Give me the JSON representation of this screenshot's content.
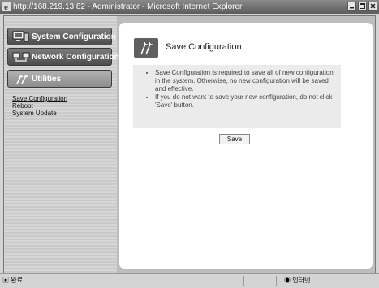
{
  "window": {
    "title": "http://168.219.13.82 - Administrator - Microsoft Internet Explorer"
  },
  "sidebar": {
    "nav": [
      {
        "label": "System Configuration",
        "icon": "monitor-icon"
      },
      {
        "label": "Network Configuration",
        "icon": "network-computers-icon"
      },
      {
        "label": "Utilities",
        "icon": "tools-icon"
      }
    ],
    "submenu": [
      {
        "label": "Save Configuration",
        "active": true
      },
      {
        "label": "Reboot",
        "active": false
      },
      {
        "label": "System Update",
        "active": false
      }
    ]
  },
  "main": {
    "title": "Save Configuration",
    "bullets": [
      "Save Configuration is required to save all of new configuration in the system. Otherwise, no new configuration will be saved and effective.",
      "If you do not want to save your new configuration, do not click 'Save' button."
    ],
    "save_label": "Save"
  },
  "statusbar": {
    "left": "완료",
    "right": "인터넷"
  },
  "colors": {
    "title_bar": "#5c5c5c",
    "nav_dark": "#5a5a5a",
    "nav_light": "#9c9c9c",
    "info_box": "#ebebeb"
  }
}
